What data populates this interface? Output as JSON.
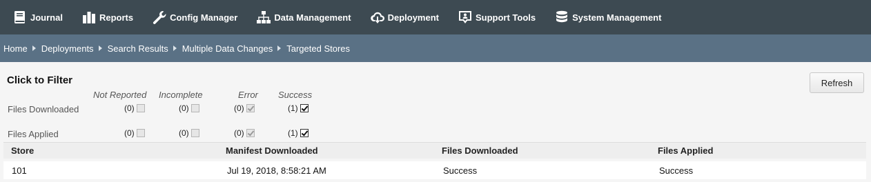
{
  "nav": {
    "items": [
      {
        "label": "Journal",
        "icon": "book-icon"
      },
      {
        "label": "Reports",
        "icon": "bar-chart-icon"
      },
      {
        "label": "Config Manager",
        "icon": "wrench-icon"
      },
      {
        "label": "Data Management",
        "icon": "sitemap-icon"
      },
      {
        "label": "Deployment",
        "icon": "cloud-download-icon"
      },
      {
        "label": "Support Tools",
        "icon": "support-icon"
      },
      {
        "label": "System Management",
        "icon": "database-icon"
      }
    ]
  },
  "breadcrumb": [
    "Home",
    "Deployments",
    "Search Results",
    "Multiple Data Changes",
    "Targeted Stores"
  ],
  "filter": {
    "title": "Click to Filter",
    "refresh_label": "Refresh",
    "columns": [
      "Not Reported",
      "Incomplete",
      "Error",
      "Success"
    ],
    "rows": [
      {
        "label": "Files Downloaded",
        "counts": [
          "(0)",
          "(0)",
          "(0)",
          "(1)"
        ]
      },
      {
        "label": "Files Applied",
        "counts": [
          "(0)",
          "(0)",
          "(0)",
          "(1)"
        ]
      }
    ]
  },
  "table": {
    "headers": [
      "Store",
      "Manifest Downloaded",
      "Files Downloaded",
      "Files Applied"
    ],
    "rows": [
      [
        "101",
        "Jul 19, 2018, 8:58:21 AM",
        "Success",
        "Success"
      ]
    ]
  },
  "colors": {
    "nav_bg": "#3d4a52",
    "breadcrumb_bg": "#5a7185",
    "content_bg": "#f5f5f5"
  }
}
